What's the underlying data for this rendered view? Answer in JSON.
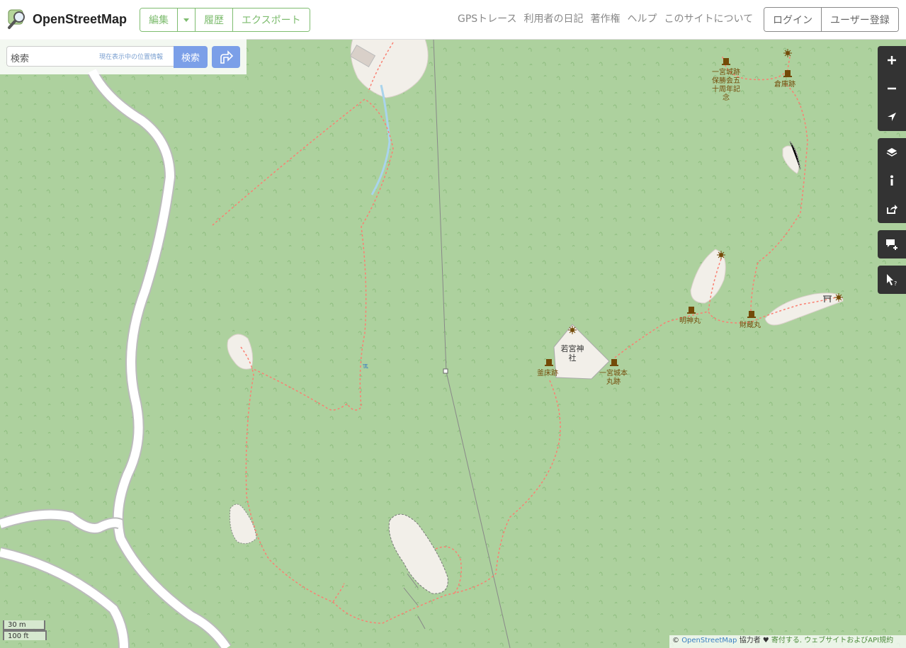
{
  "header": {
    "site_title": "OpenStreetMap",
    "edit_label": "編集",
    "history_label": "履歴",
    "export_label": "エクスポート",
    "nav": [
      "GPSトレース",
      "利用者の日記",
      "著作権",
      "ヘルプ",
      "このサイトについて"
    ],
    "login_label": "ログイン",
    "signup_label": "ユーザー登録"
  },
  "search": {
    "placeholder": "検索",
    "where_am_i": "現在表示中の位置情報",
    "button_label": "検索"
  },
  "controls": [
    "zoom-in-icon",
    "zoom-out-icon",
    "locate-icon",
    "layers-icon",
    "info-icon",
    "share-icon",
    "note-icon",
    "query-icon"
  ],
  "map": {
    "labels": {
      "monument1": "一宮城跡\n保勝会五\n十周年記\n念",
      "warehouse": "倉庫跡",
      "myojin": "明神丸",
      "zaizo": "財蔵丸",
      "shrine": "若宮神\n社",
      "kamadoko": "釜床跡",
      "honmaru": "一宮城本\n丸跡"
    }
  },
  "scale": {
    "metric": "30 m",
    "imperial": "100 ft"
  },
  "attribution": {
    "copyright": "© ",
    "osm_link": "OpenStreetMap",
    "contributors": " 協力者 ♥ ",
    "donate": "寄付する",
    "terms": ". ウェブサイトおよびAPI規約"
  },
  "colors": {
    "forest": "#add19e",
    "brand_green": "#7ebc6f",
    "search_blue": "#7b9fe8",
    "path_red": "#fa8072"
  }
}
